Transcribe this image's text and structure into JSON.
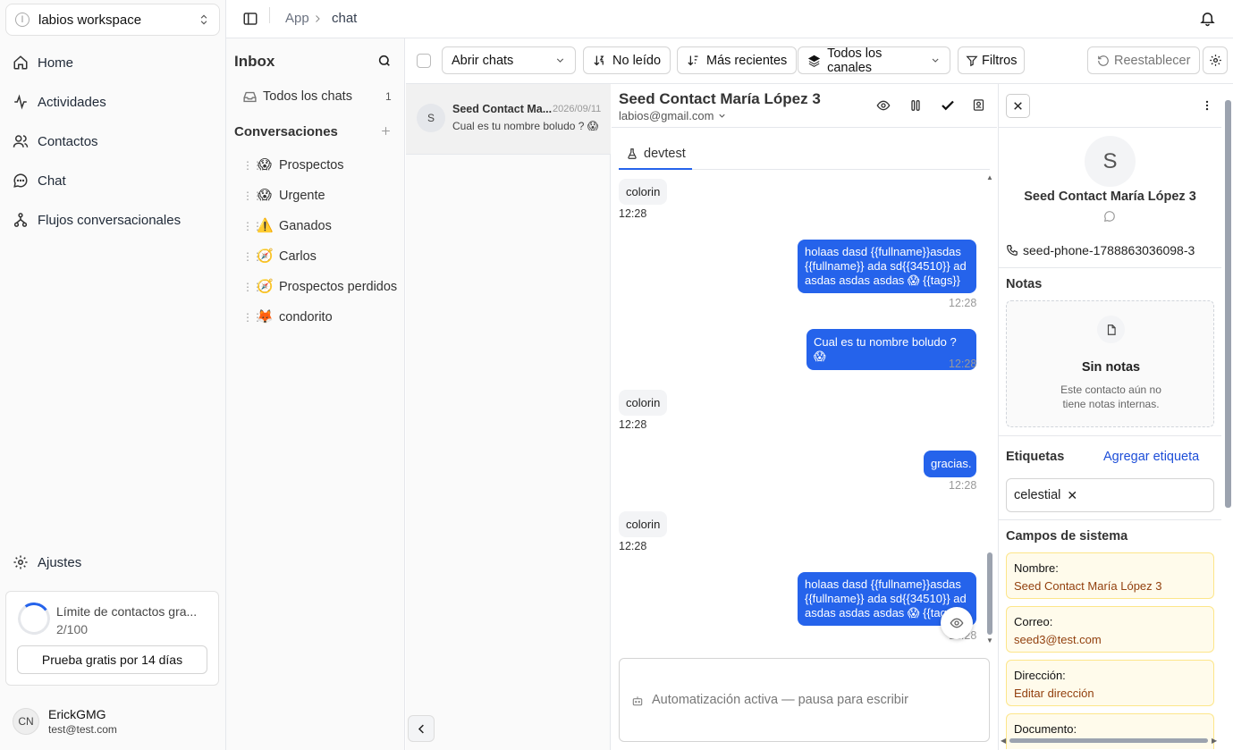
{
  "workspace": {
    "name": "labios workspace",
    "initial": "l"
  },
  "nav": [
    {
      "label": "Home"
    },
    {
      "label": "Actividades"
    },
    {
      "label": "Contactos"
    },
    {
      "label": "Chat"
    },
    {
      "label": "Flujos conversacionales"
    }
  ],
  "settings_label": "Ajustes",
  "limit": {
    "title": "Límite de contactos gra...",
    "count": "2/100",
    "progress": 0.02,
    "trial_button": "Prueba gratis por 14 días"
  },
  "user": {
    "initials": "CN",
    "name": "ErickGMG",
    "email": "test@test.com"
  },
  "breadcrumb": {
    "app": "App",
    "current": "chat"
  },
  "inbox": {
    "title": "Inbox",
    "all_chats": {
      "label": "Todos los chats",
      "count": "1"
    },
    "conversations_title": "Conversaciones",
    "folders": [
      {
        "emoji": "😱",
        "label": "Prospectos"
      },
      {
        "emoji": "😱",
        "label": "Urgente"
      },
      {
        "emoji": "⚠️",
        "label": "Ganados"
      },
      {
        "emoji": "🧭",
        "label": "Carlos"
      },
      {
        "emoji": "🧭",
        "label": "Prospectos perdidos"
      },
      {
        "emoji": "🦊",
        "label": "condorito"
      }
    ]
  },
  "toolbar": {
    "open_select": "Abrir chats",
    "unread": "No leído",
    "recent": "Más recientes",
    "channels": "Todos los canales",
    "filters": "Filtros",
    "reset": "Reestablecer"
  },
  "chat_list": [
    {
      "avatar": "S",
      "name": "Seed Contact Ma...",
      "date": "2026/09/11",
      "preview": "Cual es tu nombre boludo ? 😱"
    }
  ],
  "conversation": {
    "contact_name": "Seed Contact María López 3",
    "channel_email": "labios@gmail.com",
    "tab": "devtest",
    "messages": [
      {
        "dir": "in",
        "text": "colorin",
        "time": "12:28"
      },
      {
        "dir": "out",
        "lines": [
          "holaas dasd {{fullname}}asdas",
          "{{fullname}} ada sd{{34510}} ad",
          "asdas asdas asdas 😱 {{tags}}"
        ],
        "time": "12:28"
      },
      {
        "dir": "out",
        "lines": [
          "Cual es tu nombre boludo ? 😱"
        ],
        "time": "12:28"
      },
      {
        "dir": "in",
        "text": "colorin",
        "time": "12:28"
      },
      {
        "dir": "out",
        "lines": [
          "gracias."
        ],
        "time": "12:28"
      },
      {
        "dir": "in",
        "text": "colorin",
        "time": "12:28"
      },
      {
        "dir": "out",
        "lines": [
          "holaas dasd {{fullname}}asdas",
          "{{fullname}} ada sd{{34510}} ad",
          "asdas asdas asdas 😱 {{tags}}"
        ],
        "time": "12:28"
      }
    ],
    "composer_placeholder": "Automatización activa — pausa para escribir"
  },
  "details": {
    "avatar": "S",
    "name": "Seed Contact María López 3",
    "phone": "seed-phone-1788863036098-3",
    "notes_title": "Notas",
    "notes_empty_title": "Sin notas",
    "notes_empty_text": [
      "Este contacto aún no",
      "tiene notas internas."
    ],
    "tags_title": "Etiquetas",
    "add_tag": "Agregar etiqueta",
    "tags": [
      "celestial"
    ],
    "system_fields_title": "Campos de sistema",
    "fields": [
      {
        "label": "Nombre:",
        "value": "Seed Contact María López 3"
      },
      {
        "label": "Correo:",
        "value": "seed3@test.com"
      },
      {
        "label": "Dirección:",
        "value": "Editar dirección"
      },
      {
        "label": "Documento:",
        "value": ""
      }
    ]
  },
  "colors": {
    "accent": "#2563eb",
    "field_bg": "#fffbeb",
    "field_border": "#fde68a",
    "field_value": "#92400e"
  }
}
